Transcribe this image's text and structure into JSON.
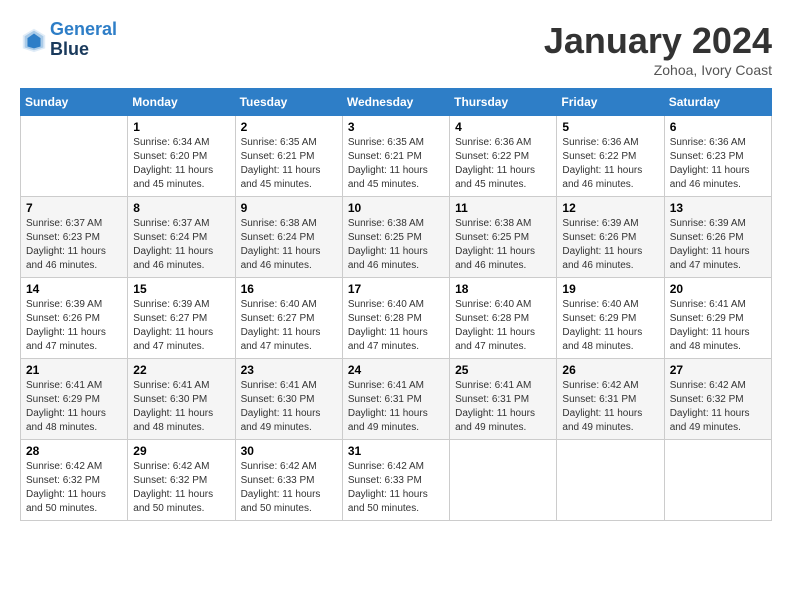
{
  "header": {
    "logo_line1": "General",
    "logo_line2": "Blue",
    "month": "January 2024",
    "location": "Zohoa, Ivory Coast"
  },
  "days_of_week": [
    "Sunday",
    "Monday",
    "Tuesday",
    "Wednesday",
    "Thursday",
    "Friday",
    "Saturday"
  ],
  "weeks": [
    [
      {
        "day": "",
        "sunrise": "",
        "sunset": "",
        "daylight": ""
      },
      {
        "day": "1",
        "sunrise": "Sunrise: 6:34 AM",
        "sunset": "Sunset: 6:20 PM",
        "daylight": "Daylight: 11 hours and 45 minutes."
      },
      {
        "day": "2",
        "sunrise": "Sunrise: 6:35 AM",
        "sunset": "Sunset: 6:21 PM",
        "daylight": "Daylight: 11 hours and 45 minutes."
      },
      {
        "day": "3",
        "sunrise": "Sunrise: 6:35 AM",
        "sunset": "Sunset: 6:21 PM",
        "daylight": "Daylight: 11 hours and 45 minutes."
      },
      {
        "day": "4",
        "sunrise": "Sunrise: 6:36 AM",
        "sunset": "Sunset: 6:22 PM",
        "daylight": "Daylight: 11 hours and 45 minutes."
      },
      {
        "day": "5",
        "sunrise": "Sunrise: 6:36 AM",
        "sunset": "Sunset: 6:22 PM",
        "daylight": "Daylight: 11 hours and 46 minutes."
      },
      {
        "day": "6",
        "sunrise": "Sunrise: 6:36 AM",
        "sunset": "Sunset: 6:23 PM",
        "daylight": "Daylight: 11 hours and 46 minutes."
      }
    ],
    [
      {
        "day": "7",
        "sunrise": "Sunrise: 6:37 AM",
        "sunset": "Sunset: 6:23 PM",
        "daylight": "Daylight: 11 hours and 46 minutes."
      },
      {
        "day": "8",
        "sunrise": "Sunrise: 6:37 AM",
        "sunset": "Sunset: 6:24 PM",
        "daylight": "Daylight: 11 hours and 46 minutes."
      },
      {
        "day": "9",
        "sunrise": "Sunrise: 6:38 AM",
        "sunset": "Sunset: 6:24 PM",
        "daylight": "Daylight: 11 hours and 46 minutes."
      },
      {
        "day": "10",
        "sunrise": "Sunrise: 6:38 AM",
        "sunset": "Sunset: 6:25 PM",
        "daylight": "Daylight: 11 hours and 46 minutes."
      },
      {
        "day": "11",
        "sunrise": "Sunrise: 6:38 AM",
        "sunset": "Sunset: 6:25 PM",
        "daylight": "Daylight: 11 hours and 46 minutes."
      },
      {
        "day": "12",
        "sunrise": "Sunrise: 6:39 AM",
        "sunset": "Sunset: 6:26 PM",
        "daylight": "Daylight: 11 hours and 46 minutes."
      },
      {
        "day": "13",
        "sunrise": "Sunrise: 6:39 AM",
        "sunset": "Sunset: 6:26 PM",
        "daylight": "Daylight: 11 hours and 47 minutes."
      }
    ],
    [
      {
        "day": "14",
        "sunrise": "Sunrise: 6:39 AM",
        "sunset": "Sunset: 6:26 PM",
        "daylight": "Daylight: 11 hours and 47 minutes."
      },
      {
        "day": "15",
        "sunrise": "Sunrise: 6:39 AM",
        "sunset": "Sunset: 6:27 PM",
        "daylight": "Daylight: 11 hours and 47 minutes."
      },
      {
        "day": "16",
        "sunrise": "Sunrise: 6:40 AM",
        "sunset": "Sunset: 6:27 PM",
        "daylight": "Daylight: 11 hours and 47 minutes."
      },
      {
        "day": "17",
        "sunrise": "Sunrise: 6:40 AM",
        "sunset": "Sunset: 6:28 PM",
        "daylight": "Daylight: 11 hours and 47 minutes."
      },
      {
        "day": "18",
        "sunrise": "Sunrise: 6:40 AM",
        "sunset": "Sunset: 6:28 PM",
        "daylight": "Daylight: 11 hours and 47 minutes."
      },
      {
        "day": "19",
        "sunrise": "Sunrise: 6:40 AM",
        "sunset": "Sunset: 6:29 PM",
        "daylight": "Daylight: 11 hours and 48 minutes."
      },
      {
        "day": "20",
        "sunrise": "Sunrise: 6:41 AM",
        "sunset": "Sunset: 6:29 PM",
        "daylight": "Daylight: 11 hours and 48 minutes."
      }
    ],
    [
      {
        "day": "21",
        "sunrise": "Sunrise: 6:41 AM",
        "sunset": "Sunset: 6:29 PM",
        "daylight": "Daylight: 11 hours and 48 minutes."
      },
      {
        "day": "22",
        "sunrise": "Sunrise: 6:41 AM",
        "sunset": "Sunset: 6:30 PM",
        "daylight": "Daylight: 11 hours and 48 minutes."
      },
      {
        "day": "23",
        "sunrise": "Sunrise: 6:41 AM",
        "sunset": "Sunset: 6:30 PM",
        "daylight": "Daylight: 11 hours and 49 minutes."
      },
      {
        "day": "24",
        "sunrise": "Sunrise: 6:41 AM",
        "sunset": "Sunset: 6:31 PM",
        "daylight": "Daylight: 11 hours and 49 minutes."
      },
      {
        "day": "25",
        "sunrise": "Sunrise: 6:41 AM",
        "sunset": "Sunset: 6:31 PM",
        "daylight": "Daylight: 11 hours and 49 minutes."
      },
      {
        "day": "26",
        "sunrise": "Sunrise: 6:42 AM",
        "sunset": "Sunset: 6:31 PM",
        "daylight": "Daylight: 11 hours and 49 minutes."
      },
      {
        "day": "27",
        "sunrise": "Sunrise: 6:42 AM",
        "sunset": "Sunset: 6:32 PM",
        "daylight": "Daylight: 11 hours and 49 minutes."
      }
    ],
    [
      {
        "day": "28",
        "sunrise": "Sunrise: 6:42 AM",
        "sunset": "Sunset: 6:32 PM",
        "daylight": "Daylight: 11 hours and 50 minutes."
      },
      {
        "day": "29",
        "sunrise": "Sunrise: 6:42 AM",
        "sunset": "Sunset: 6:32 PM",
        "daylight": "Daylight: 11 hours and 50 minutes."
      },
      {
        "day": "30",
        "sunrise": "Sunrise: 6:42 AM",
        "sunset": "Sunset: 6:33 PM",
        "daylight": "Daylight: 11 hours and 50 minutes."
      },
      {
        "day": "31",
        "sunrise": "Sunrise: 6:42 AM",
        "sunset": "Sunset: 6:33 PM",
        "daylight": "Daylight: 11 hours and 50 minutes."
      },
      {
        "day": "",
        "sunrise": "",
        "sunset": "",
        "daylight": ""
      },
      {
        "day": "",
        "sunrise": "",
        "sunset": "",
        "daylight": ""
      },
      {
        "day": "",
        "sunrise": "",
        "sunset": "",
        "daylight": ""
      }
    ]
  ]
}
